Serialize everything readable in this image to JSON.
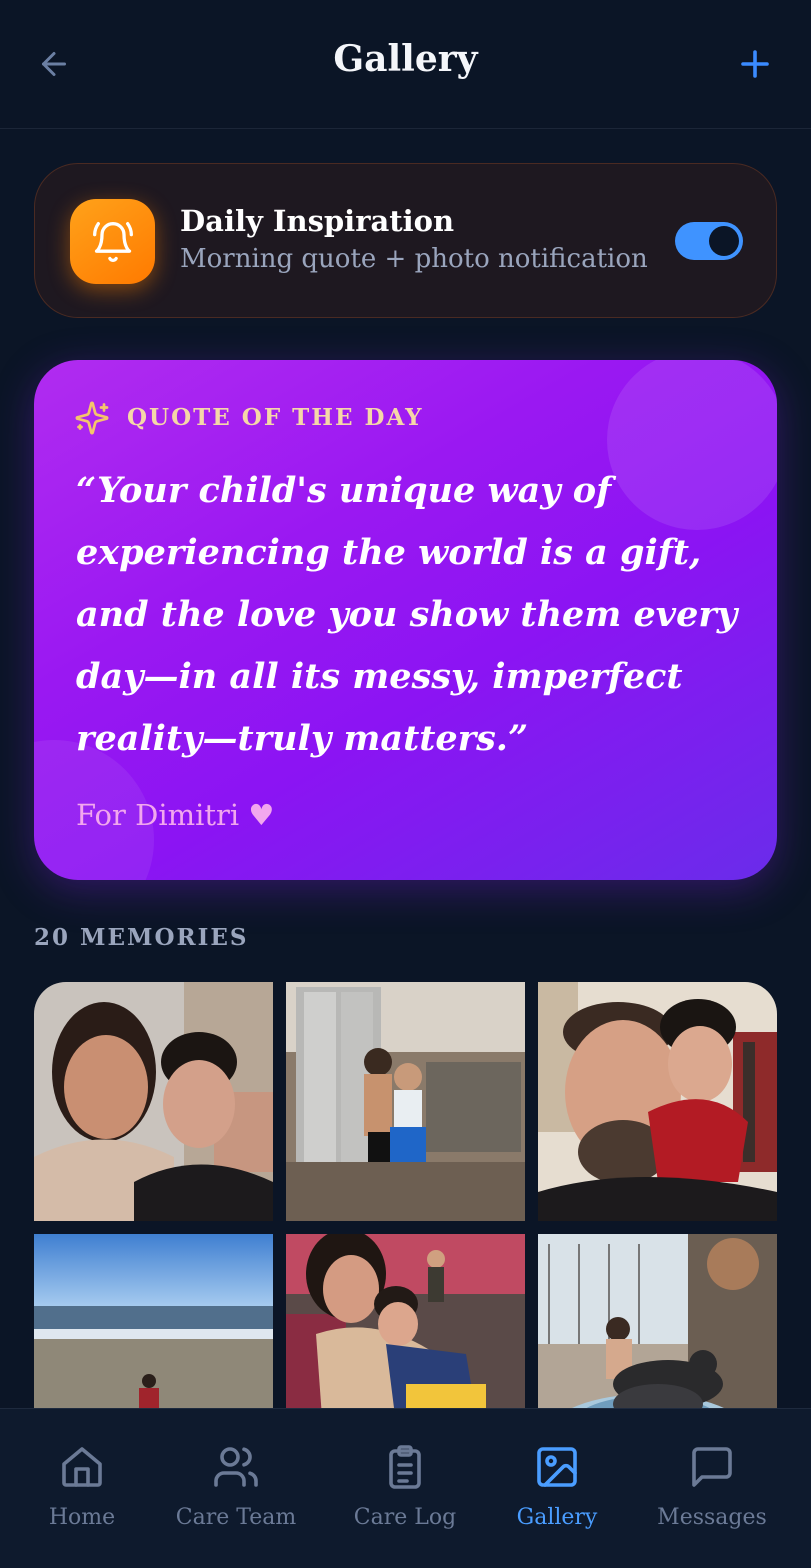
{
  "header": {
    "title": "Gallery",
    "back_icon": "arrow-left-icon",
    "add_icon": "plus-icon",
    "accent": "#3b8bff"
  },
  "inspiration": {
    "title": "Daily Inspiration",
    "subtitle": "Morning quote + photo notification",
    "icon": "bell-icon",
    "toggle_on": true,
    "tile_color": "#ff8a00",
    "toggle_color": "#3f93ff"
  },
  "quote": {
    "label": "QUOTE OF THE DAY",
    "icon": "sparkles-icon",
    "text": "“Your child's unique way of experiencing the world is a gift, and the love you show them every day—in all its messy, imperfect reality—truly matters.”",
    "signature": "For Dimitri ♥",
    "gradient_start": "#b12cf0",
    "gradient_end": "#6a2cea"
  },
  "memories": {
    "label": "20 MEMORIES",
    "count": 20,
    "photos": [
      {
        "name": "photo-mother-and-son-selfie"
      },
      {
        "name": "photo-two-kids-in-kitchen"
      },
      {
        "name": "photo-father-and-son-hug"
      },
      {
        "name": "photo-child-on-beach"
      },
      {
        "name": "photo-mother-hugging-son"
      },
      {
        "name": "photo-child-with-dogs"
      }
    ]
  },
  "nav": {
    "items": [
      {
        "label": "Home",
        "icon": "home-icon",
        "active": false
      },
      {
        "label": "Care Team",
        "icon": "users-icon",
        "active": false
      },
      {
        "label": "Care Log",
        "icon": "clipboard-list-icon",
        "active": false
      },
      {
        "label": "Gallery",
        "icon": "image-icon",
        "active": true
      },
      {
        "label": "Messages",
        "icon": "message-square-icon",
        "active": false
      }
    ],
    "active_color": "#4a9dff",
    "inactive_color": "#6b7a96"
  }
}
